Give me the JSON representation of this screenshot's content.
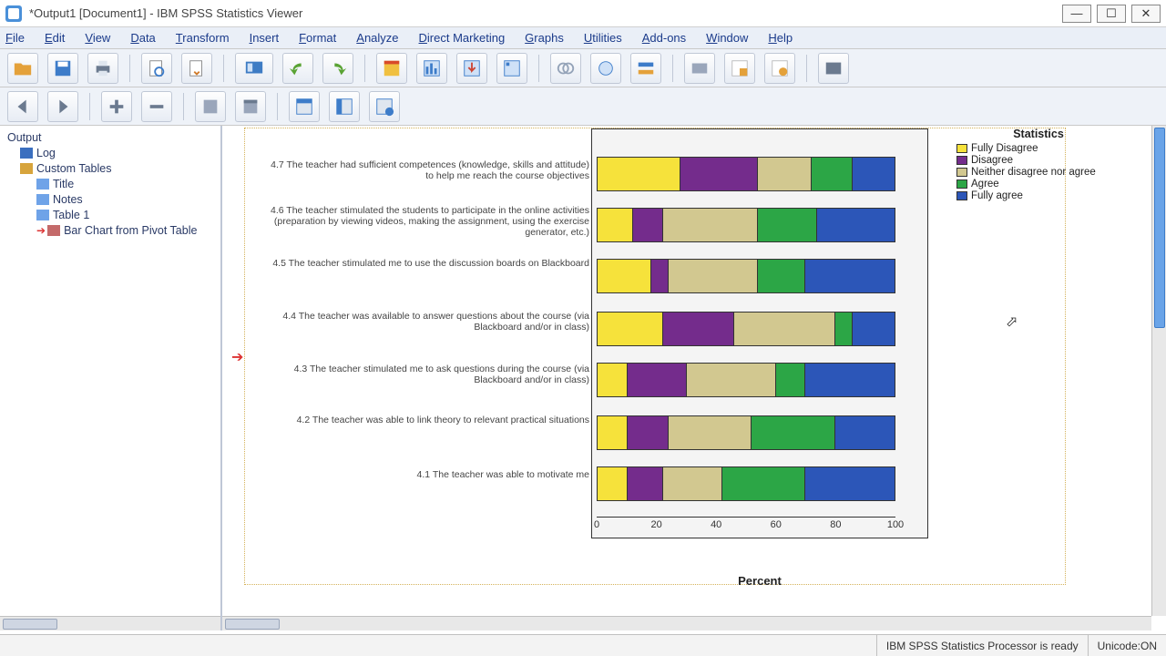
{
  "title": "*Output1 [Document1] - IBM SPSS Statistics Viewer",
  "menu": [
    "File",
    "Edit",
    "View",
    "Data",
    "Transform",
    "Insert",
    "Format",
    "Analyze",
    "Direct Marketing",
    "Graphs",
    "Utilities",
    "Add-ons",
    "Window",
    "Help"
  ],
  "outline": {
    "root": "Output",
    "log": "Log",
    "group": "Custom Tables",
    "children": [
      "Title",
      "Notes",
      "Table 1",
      "Bar Chart from Pivot Table"
    ]
  },
  "legend": {
    "title": "Statistics",
    "items": [
      {
        "label": "Fully Disagree",
        "cls": "c-fd"
      },
      {
        "label": "Disagree",
        "cls": "c-d"
      },
      {
        "label": "Neither disagree nor agree",
        "cls": "c-n"
      },
      {
        "label": "Agree",
        "cls": "c-a"
      },
      {
        "label": "Fully agree",
        "cls": "c-fa"
      }
    ]
  },
  "status": {
    "processor": "IBM SPSS Statistics Processor is ready",
    "unicode": "Unicode:ON"
  },
  "xlabel": "Percent",
  "xticks": [
    "0",
    "20",
    "40",
    "60",
    "80",
    "100"
  ],
  "chart_data": {
    "type": "bar",
    "orientation": "horizontal-stacked",
    "xlabel": "Percent",
    "xlim": [
      0,
      100
    ],
    "legend_title": "Statistics",
    "series_names": [
      "Fully Disagree",
      "Disagree",
      "Neither disagree nor agree",
      "Agree",
      "Fully agree"
    ],
    "categories": [
      "4.7 The teacher had sufficient competences (knowledge, skills and attitude) to help me reach the course objectives",
      "4.6 The teacher stimulated the students to participate in the online activities (preparation by viewing videos, making the assignment, using the exercise generator, etc.)",
      "4.5 The teacher stimulated me to use the discussion boards on Blackboard",
      "4.4 The teacher was available to answer questions about the course (via Blackboard and/or in class)",
      "4.3 The teacher stimulated me to ask questions during the course (via Blackboard and/or in class)",
      "4.2 The teacher was able to link theory to relevant practical situations",
      "4.1 The teacher was able to motivate me"
    ],
    "values": [
      [
        28,
        26,
        18,
        14,
        14
      ],
      [
        12,
        10,
        32,
        20,
        26
      ],
      [
        18,
        6,
        30,
        16,
        30
      ],
      [
        22,
        24,
        34,
        6,
        14
      ],
      [
        10,
        20,
        30,
        10,
        30
      ],
      [
        10,
        14,
        28,
        28,
        20
      ],
      [
        10,
        12,
        20,
        28,
        30
      ]
    ]
  }
}
